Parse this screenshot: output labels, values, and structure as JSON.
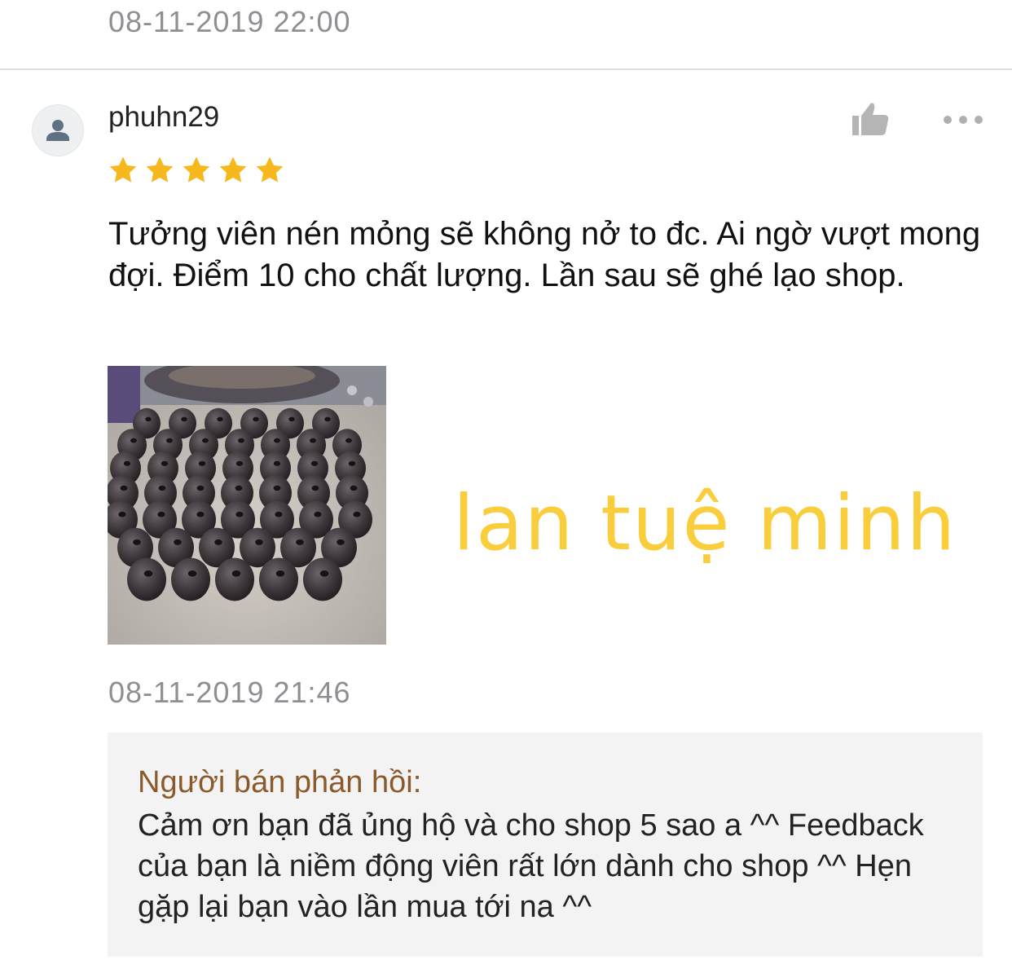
{
  "previous_review": {
    "timestamp": "08-11-2019 22:00"
  },
  "review": {
    "avatar_icon": "user-silhouette-icon",
    "username": "phuhn29",
    "rating": 5,
    "rating_max": 5,
    "text": "Tưởng viên nén mỏng sẽ không nở to đc. Ai ngờ vượt mong đợi. Điểm 10 cho chất lượng. Lần sau sẽ ghé lạo shop.",
    "photo_icon": "review-photo",
    "watermark": "lan tuệ minh",
    "timestamp": "08-11-2019 21:46"
  },
  "actions": {
    "like_icon": "thumbs-up-icon",
    "more_icon": "more-dots-icon"
  },
  "seller_reply": {
    "label": "Người bán phản hồi:",
    "text": "Cảm ơn bạn đã ủng hộ và cho shop 5 sao a ^^ Feedback của bạn là niềm động viên rất lớn dành cho shop ^^ Hẹn gặp lại bạn vào lần mua tới na ^^"
  },
  "colors": {
    "star": "#f6b81c",
    "timestamp": "#8e8e93",
    "seller_label": "#8b5a2b",
    "watermark": "#f9cd3c",
    "reply_background": "#f3f3f3"
  }
}
